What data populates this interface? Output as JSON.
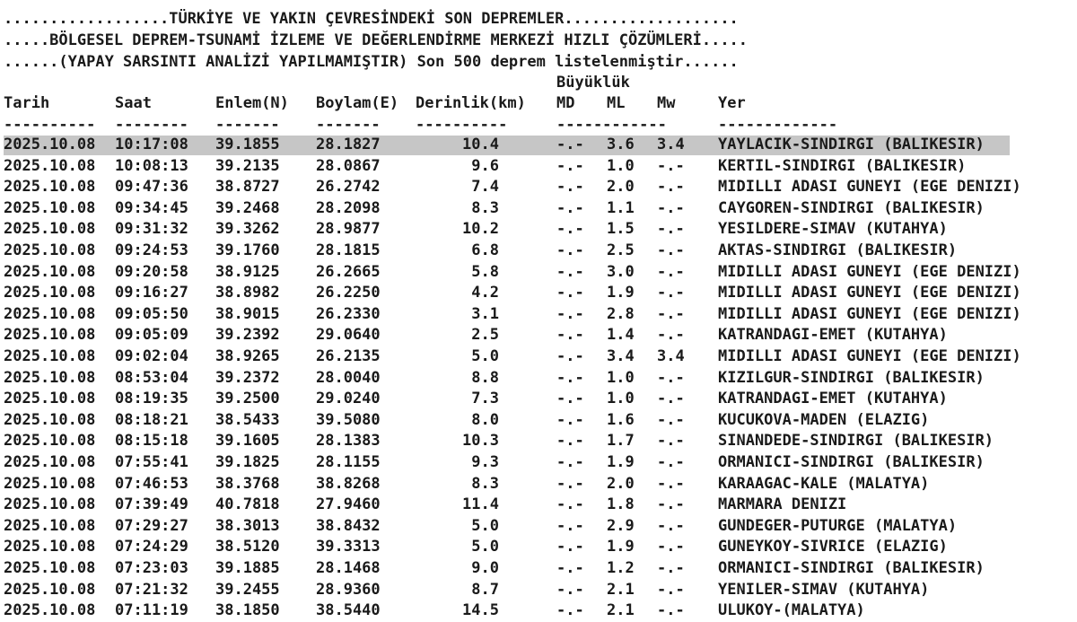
{
  "header": {
    "line1": "..................TÜRKİYE VE YAKIN ÇEVRESİNDEKİ SON DEPREMLER...................",
    "line2": ".....BÖLGESEL DEPREM-TSUNAMİ İZLEME VE DEĞERLENDİRME MERKEZİ HIZLI ÇÖZÜMLERİ.....",
    "line3": "......(YAPAY SARSINTI ANALİZİ YAPILMAMIŞTIR) Son 500 deprem listelenmiştir......"
  },
  "columns": {
    "group_magnitude": "Büyüklük",
    "tarih": "Tarih",
    "saat": "Saat",
    "enlem": "Enlem(N)",
    "boylam": "Boylam(E)",
    "derinlik": "Derinlik(km)",
    "md": "MD",
    "ml": "ML",
    "mw": "Mw",
    "yer": "Yer"
  },
  "separators": {
    "tarih": "----------",
    "saat": "--------",
    "enlem": "-------",
    "boylam": "-------",
    "derinlik": "----------",
    "magnitude": "------------",
    "yer": "-------------"
  },
  "rows": [
    {
      "tarih": "2025.10.08",
      "saat": "10:17:08",
      "enlem": "39.1855",
      "boylam": "28.1827",
      "derinlik": "10.4",
      "md": "-.-",
      "ml": "3.6",
      "mw": "3.4",
      "yer": "YAYLACIK-SINDIRGI (BALIKESIR)"
    },
    {
      "tarih": "2025.10.08",
      "saat": "10:08:13",
      "enlem": "39.2135",
      "boylam": "28.0867",
      "derinlik": "9.6",
      "md": "-.-",
      "ml": "1.0",
      "mw": "-.-",
      "yer": "KERTIL-SINDIRGI (BALIKESIR)"
    },
    {
      "tarih": "2025.10.08",
      "saat": "09:47:36",
      "enlem": "38.8727",
      "boylam": "26.2742",
      "derinlik": "7.4",
      "md": "-.-",
      "ml": "2.0",
      "mw": "-.-",
      "yer": "MIDILLI ADASI GUNEYI (EGE DENIZI)"
    },
    {
      "tarih": "2025.10.08",
      "saat": "09:34:45",
      "enlem": "39.2468",
      "boylam": "28.2098",
      "derinlik": "8.3",
      "md": "-.-",
      "ml": "1.1",
      "mw": "-.-",
      "yer": "CAYGOREN-SINDIRGI (BALIKESIR)"
    },
    {
      "tarih": "2025.10.08",
      "saat": "09:31:32",
      "enlem": "39.3262",
      "boylam": "28.9877",
      "derinlik": "10.2",
      "md": "-.-",
      "ml": "1.5",
      "mw": "-.-",
      "yer": "YESILDERE-SIMAV (KUTAHYA)"
    },
    {
      "tarih": "2025.10.08",
      "saat": "09:24:53",
      "enlem": "39.1760",
      "boylam": "28.1815",
      "derinlik": "6.8",
      "md": "-.-",
      "ml": "2.5",
      "mw": "-.-",
      "yer": "AKTAS-SINDIRGI (BALIKESIR)"
    },
    {
      "tarih": "2025.10.08",
      "saat": "09:20:58",
      "enlem": "38.9125",
      "boylam": "26.2665",
      "derinlik": "5.8",
      "md": "-.-",
      "ml": "3.0",
      "mw": "-.-",
      "yer": "MIDILLI ADASI GUNEYI (EGE DENIZI)"
    },
    {
      "tarih": "2025.10.08",
      "saat": "09:16:27",
      "enlem": "38.8982",
      "boylam": "26.2250",
      "derinlik": "4.2",
      "md": "-.-",
      "ml": "1.9",
      "mw": "-.-",
      "yer": "MIDILLI ADASI GUNEYI (EGE DENIZI)"
    },
    {
      "tarih": "2025.10.08",
      "saat": "09:05:50",
      "enlem": "38.9015",
      "boylam": "26.2330",
      "derinlik": "3.1",
      "md": "-.-",
      "ml": "2.8",
      "mw": "-.-",
      "yer": "MIDILLI ADASI GUNEYI (EGE DENIZI)"
    },
    {
      "tarih": "2025.10.08",
      "saat": "09:05:09",
      "enlem": "39.2392",
      "boylam": "29.0640",
      "derinlik": "2.5",
      "md": "-.-",
      "ml": "1.4",
      "mw": "-.-",
      "yer": "KATRANDAGI-EMET (KUTAHYA)"
    },
    {
      "tarih": "2025.10.08",
      "saat": "09:02:04",
      "enlem": "38.9265",
      "boylam": "26.2135",
      "derinlik": "5.0",
      "md": "-.-",
      "ml": "3.4",
      "mw": "3.4",
      "yer": "MIDILLI ADASI GUNEYI (EGE DENIZI)"
    },
    {
      "tarih": "2025.10.08",
      "saat": "08:53:04",
      "enlem": "39.2372",
      "boylam": "28.0040",
      "derinlik": "8.8",
      "md": "-.-",
      "ml": "1.0",
      "mw": "-.-",
      "yer": "KIZILGUR-SINDIRGI (BALIKESIR)"
    },
    {
      "tarih": "2025.10.08",
      "saat": "08:19:35",
      "enlem": "39.2500",
      "boylam": "29.0240",
      "derinlik": "7.3",
      "md": "-.-",
      "ml": "1.0",
      "mw": "-.-",
      "yer": "KATRANDAGI-EMET (KUTAHYA)"
    },
    {
      "tarih": "2025.10.08",
      "saat": "08:18:21",
      "enlem": "38.5433",
      "boylam": "39.5080",
      "derinlik": "8.0",
      "md": "-.-",
      "ml": "1.6",
      "mw": "-.-",
      "yer": "KUCUKOVA-MADEN (ELAZIG)"
    },
    {
      "tarih": "2025.10.08",
      "saat": "08:15:18",
      "enlem": "39.1605",
      "boylam": "28.1383",
      "derinlik": "10.3",
      "md": "-.-",
      "ml": "1.7",
      "mw": "-.-",
      "yer": "SINANDEDE-SINDIRGI (BALIKESIR)"
    },
    {
      "tarih": "2025.10.08",
      "saat": "07:55:41",
      "enlem": "39.1825",
      "boylam": "28.1155",
      "derinlik": "9.3",
      "md": "-.-",
      "ml": "1.9",
      "mw": "-.-",
      "yer": "ORMANICI-SINDIRGI (BALIKESIR)"
    },
    {
      "tarih": "2025.10.08",
      "saat": "07:46:53",
      "enlem": "38.3768",
      "boylam": "38.8268",
      "derinlik": "8.3",
      "md": "-.-",
      "ml": "2.0",
      "mw": "-.-",
      "yer": "KARAAGAC-KALE (MALATYA)"
    },
    {
      "tarih": "2025.10.08",
      "saat": "07:39:49",
      "enlem": "40.7818",
      "boylam": "27.9460",
      "derinlik": "11.4",
      "md": "-.-",
      "ml": "1.8",
      "mw": "-.-",
      "yer": "MARMARA DENIZI"
    },
    {
      "tarih": "2025.10.08",
      "saat": "07:29:27",
      "enlem": "38.3013",
      "boylam": "38.8432",
      "derinlik": "5.0",
      "md": "-.-",
      "ml": "2.9",
      "mw": "-.-",
      "yer": "GUNDEGER-PUTURGE (MALATYA)"
    },
    {
      "tarih": "2025.10.08",
      "saat": "07:24:29",
      "enlem": "38.5120",
      "boylam": "39.3313",
      "derinlik": "5.0",
      "md": "-.-",
      "ml": "1.9",
      "mw": "-.-",
      "yer": "GUNEYKOY-SIVRICE (ELAZIG)"
    },
    {
      "tarih": "2025.10.08",
      "saat": "07:23:03",
      "enlem": "39.1885",
      "boylam": "28.1468",
      "derinlik": "9.0",
      "md": "-.-",
      "ml": "1.2",
      "mw": "-.-",
      "yer": "ORMANICI-SINDIRGI (BALIKESIR)"
    },
    {
      "tarih": "2025.10.08",
      "saat": "07:21:32",
      "enlem": "39.2455",
      "boylam": "28.9360",
      "derinlik": "8.7",
      "md": "-.-",
      "ml": "2.1",
      "mw": "-.-",
      "yer": "YENILER-SIMAV (KUTAHYA)"
    },
    {
      "tarih": "2025.10.08",
      "saat": "07:11:19",
      "enlem": "38.1850",
      "boylam": "38.5440",
      "derinlik": "14.5",
      "md": "-.-",
      "ml": "2.1",
      "mw": "-.-",
      "yer": "ULUKOY-(MALATYA)"
    }
  ]
}
